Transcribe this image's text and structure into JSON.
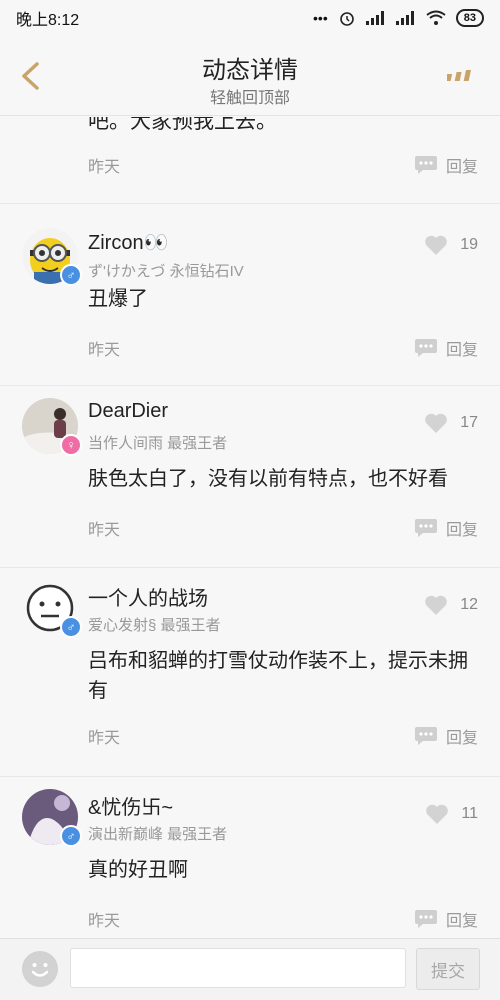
{
  "status_bar": {
    "time": "晚上8:12",
    "battery": "83"
  },
  "nav": {
    "title": "动态详情",
    "subtitle": "轻触回顶部"
  },
  "partial": {
    "text": "吧。大家预我上去。",
    "time": "昨天",
    "reply": "回复"
  },
  "comments": [
    {
      "name": "Zircon👀",
      "sub": "ず'けかえづ 永恒钻石IV",
      "likes": "19",
      "text": "丑爆了",
      "time": "昨天",
      "reply": "回复"
    },
    {
      "name": "DearDier",
      "sub": "当作人间雨 最强王者",
      "likes": "17",
      "text": "肤色太白了，没有以前有特点，也不好看",
      "time": "昨天",
      "reply": "回复"
    },
    {
      "name": "一个人的战场",
      "sub": "爱心发射§ 最强王者",
      "likes": "12",
      "text": "吕布和貂蝉的打雪仗动作装不上，提示未拥有",
      "time": "昨天",
      "reply": "回复"
    },
    {
      "name": "&忧伤卐~",
      "sub": "演出新巅峰 最强王者",
      "likes": "11",
      "text": "真的好丑啊",
      "time": "昨天",
      "reply": "回复"
    }
  ],
  "bottom": {
    "input_value": "",
    "submit_label": "提交"
  },
  "colors": {
    "accent": "#c8a46a",
    "male": "#4a90e2",
    "female": "#f06ca4"
  }
}
